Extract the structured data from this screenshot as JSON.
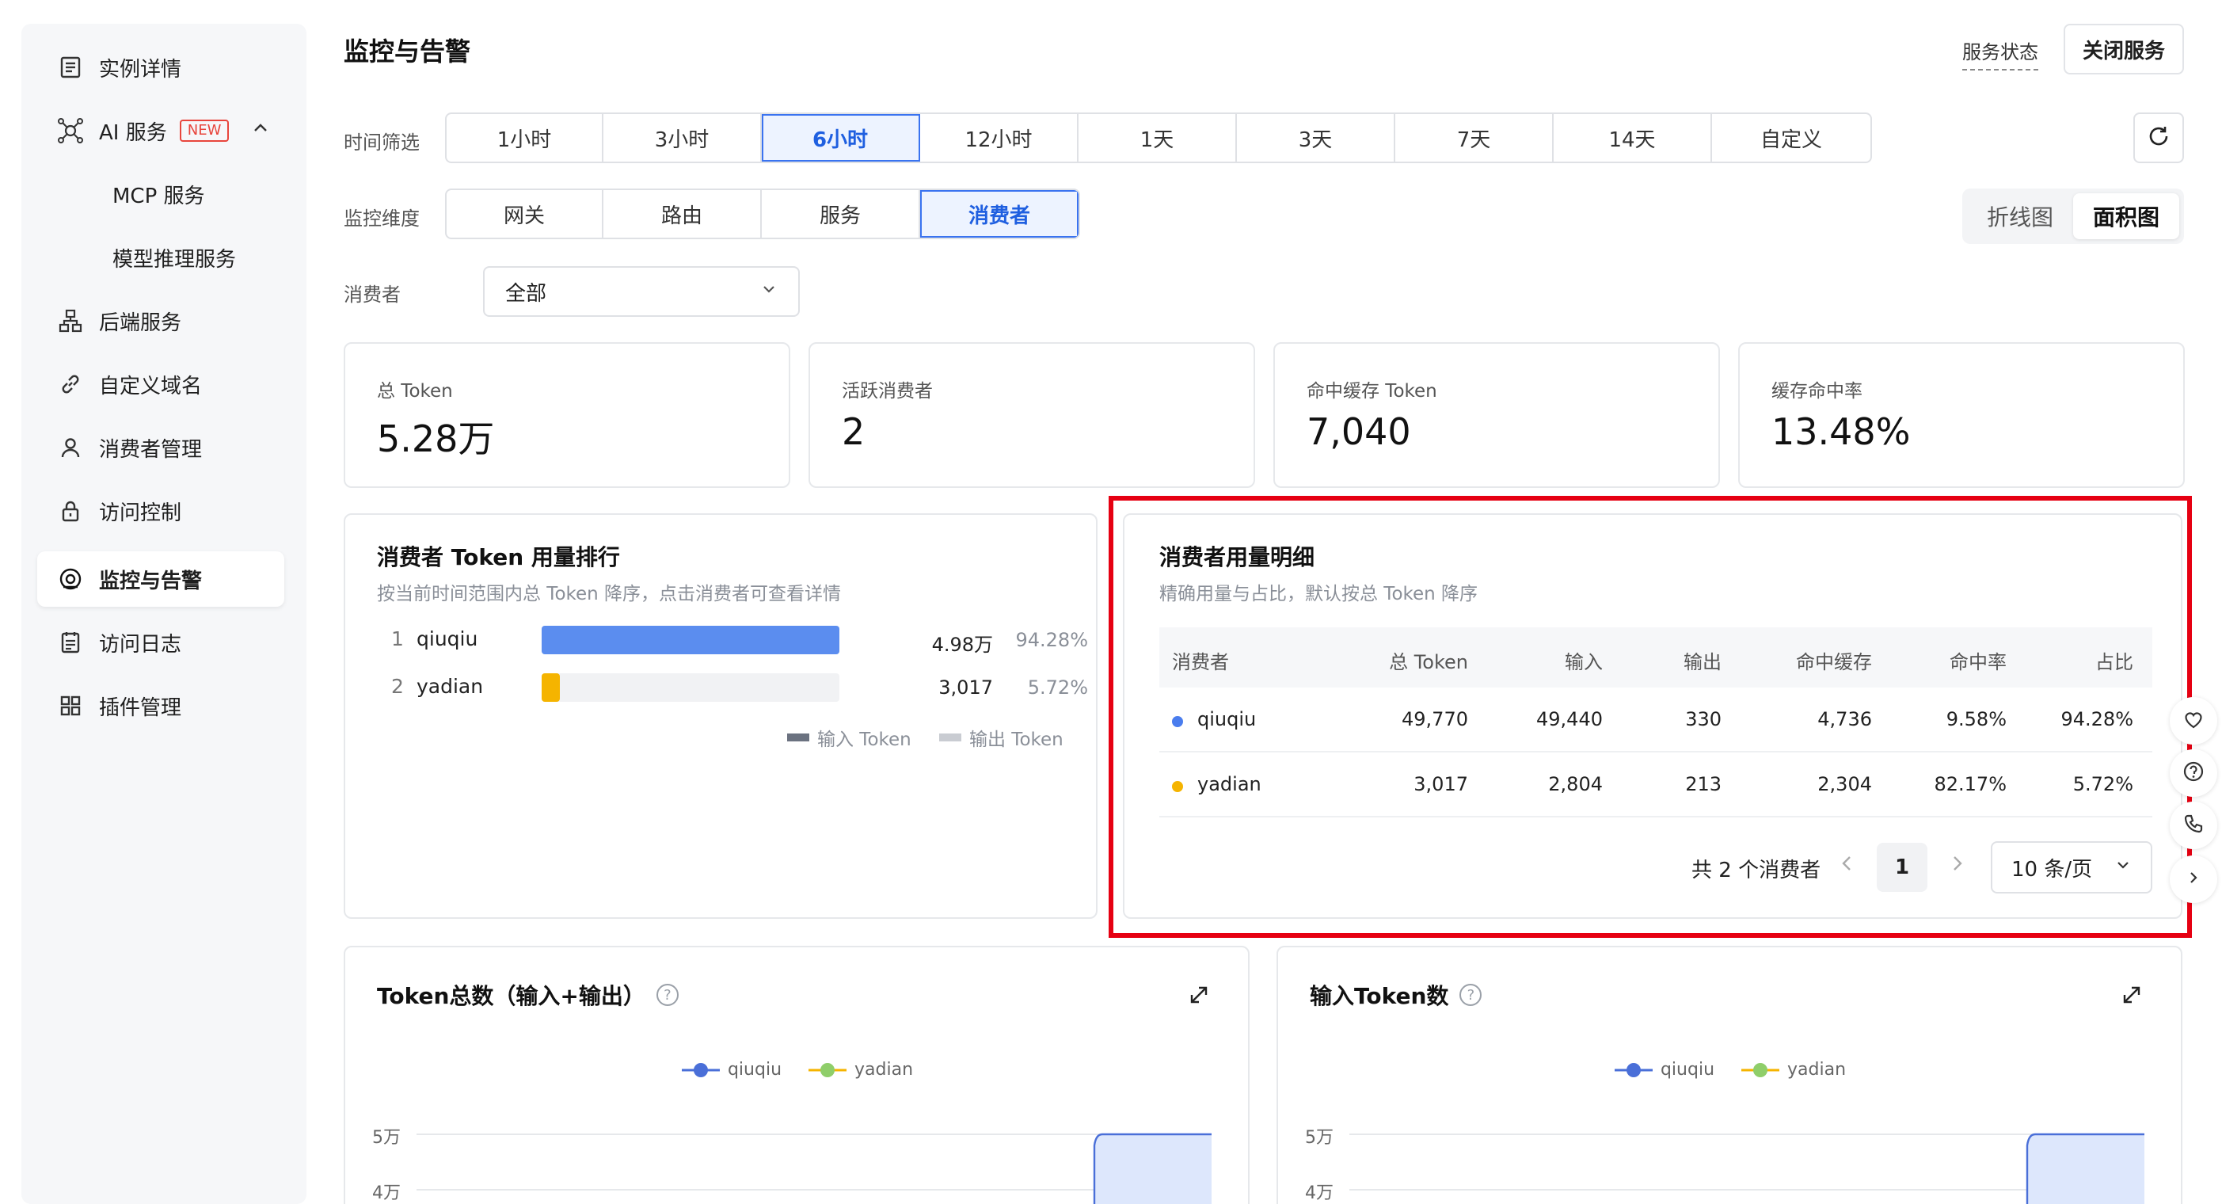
{
  "sidebar": {
    "items": [
      {
        "label": "实例详情",
        "icon": "list-doc-icon"
      },
      {
        "label": "AI 服务",
        "icon": "ai-network-icon",
        "badge": "NEW"
      },
      {
        "label": "MCP 服务"
      },
      {
        "label": "模型推理服务"
      },
      {
        "label": "后端服务",
        "icon": "hierarchy-icon"
      },
      {
        "label": "自定义域名",
        "icon": "link-icon"
      },
      {
        "label": "消费者管理",
        "icon": "user-icon"
      },
      {
        "label": "访问控制",
        "icon": "lock-icon"
      },
      {
        "label": "监控与告警",
        "icon": "monitor-icon"
      },
      {
        "label": "访问日志",
        "icon": "log-icon"
      },
      {
        "label": "插件管理",
        "icon": "grid-icon"
      }
    ]
  },
  "header": {
    "title": "监控与告警",
    "status_link": "服务状态",
    "close_button": "关闭服务"
  },
  "filters": {
    "time_label": "时间筛选",
    "time_options": [
      "1小时",
      "3小时",
      "6小时",
      "12小时",
      "1天",
      "3天",
      "7天",
      "14天",
      "自定义"
    ],
    "time_selected": "6小时",
    "dimension_label": "监控维度",
    "dimension_options": [
      "网关",
      "路由",
      "服务",
      "消费者"
    ],
    "dimension_selected": "消费者",
    "consumer_label": "消费者",
    "consumer_value": "全部",
    "chart_types": [
      "折线图",
      "面积图"
    ],
    "chart_type_selected": "面积图"
  },
  "kpis": [
    {
      "label": "总 Token",
      "value": "5.28万"
    },
    {
      "label": "活跃消费者",
      "value": "2"
    },
    {
      "label": "命中缓存 Token",
      "value": "7,040"
    },
    {
      "label": "缓存命中率",
      "value": "13.48%"
    }
  ],
  "ranking": {
    "title": "消费者 Token 用量排行",
    "subtitle": "按当前时间范围内总 Token 降序，点击消费者可查看详情",
    "rows": [
      {
        "rank": "1",
        "name": "qiuqiu",
        "value": "4.98万",
        "pct": "94.28%",
        "fraction": 1.0
      },
      {
        "rank": "2",
        "name": "yadian",
        "value": "3,017",
        "pct": "5.72%",
        "fraction": 0.06
      }
    ],
    "legend_input": "输入 Token",
    "legend_output": "输出 Token"
  },
  "detail": {
    "title": "消费者用量明细",
    "subtitle": "精确用量与占比，默认按总 Token 降序",
    "columns": [
      "消费者",
      "总 Token",
      "输入",
      "输出",
      "命中缓存",
      "命中率",
      "占比"
    ],
    "rows": [
      {
        "name": "qiuqiu",
        "total": "49,770",
        "input": "49,440",
        "output": "330",
        "cache": "4,736",
        "rate": "9.58%",
        "share": "94.28%",
        "color": "#4a7dee"
      },
      {
        "name": "yadian",
        "total": "3,017",
        "input": "2,804",
        "output": "213",
        "cache": "2,304",
        "rate": "82.17%",
        "share": "5.72%",
        "color": "#f5b400"
      }
    ],
    "pager": {
      "total_text": "共 2 个消费者",
      "current_page": "1",
      "page_size": "10 条/页"
    }
  },
  "charts": [
    {
      "title": "Token总数（输入+输出）",
      "help": "?",
      "series": [
        "qiuqiu",
        "yadian"
      ],
      "y_ticks": [
        "5万",
        "4万"
      ]
    },
    {
      "title": "输入Token数",
      "help": "?",
      "series": [
        "qiuqiu",
        "yadian"
      ],
      "y_ticks": [
        "5万",
        "4万"
      ]
    }
  ],
  "colors": {
    "accent": "#3a73f0",
    "qiuqiu": "#4a6fd8",
    "yadian": "#8fce6a",
    "highlight": "#e60012"
  }
}
